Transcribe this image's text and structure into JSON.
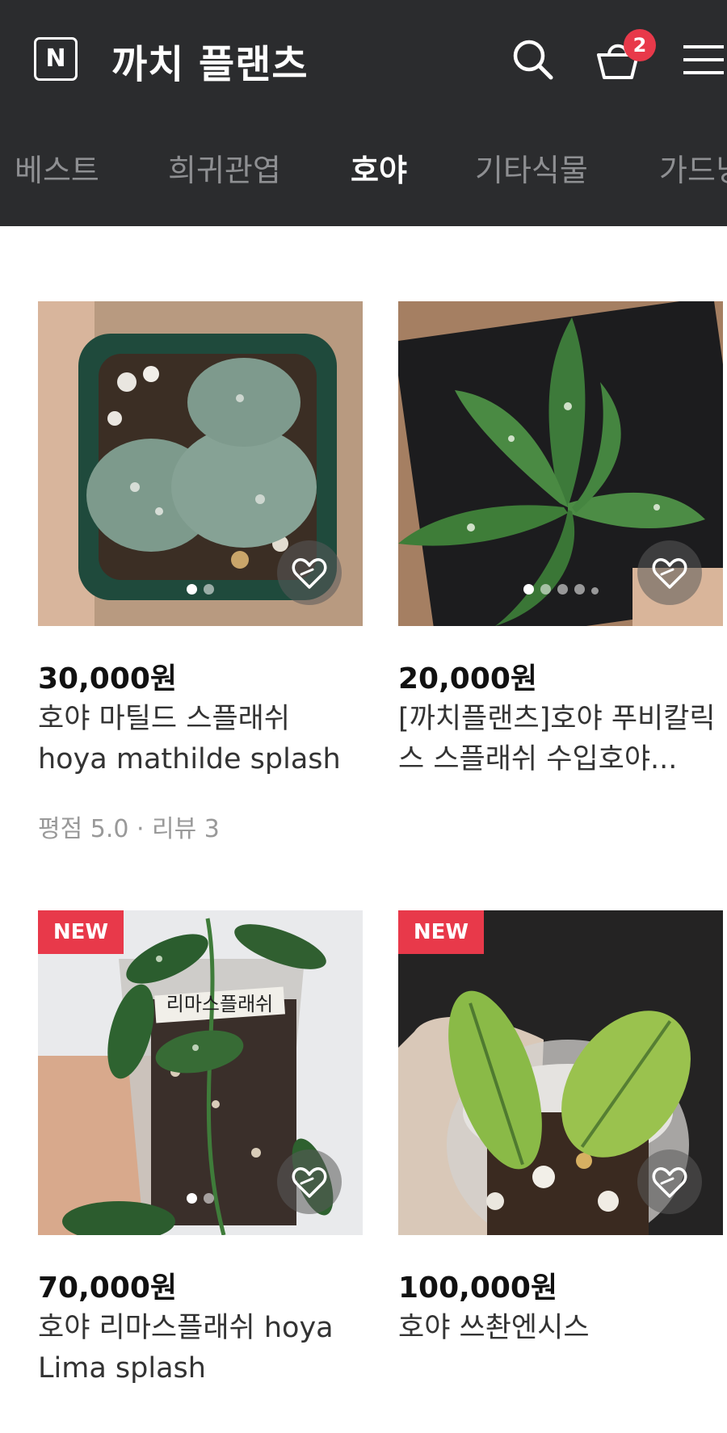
{
  "header": {
    "logo_letter": "N",
    "store_name": "까치 플랜츠",
    "cart_count": "2"
  },
  "tabs": [
    {
      "label": "베스트",
      "active": false
    },
    {
      "label": "희귀관엽",
      "active": false
    },
    {
      "label": "호야",
      "active": true
    },
    {
      "label": "기타식물",
      "active": false
    },
    {
      "label": "가드닝",
      "active": false
    }
  ],
  "products": [
    {
      "price": "30,000원",
      "name": "호야 마틸드 스플래쉬 hoya mathilde splash",
      "rating": "평점 5.0 · 리뷰 3",
      "badge": "",
      "image_dots": 2,
      "image_index": 0
    },
    {
      "price": "20,000원",
      "name": "[까치플랜츠]호야 푸비칼릭스 스플래쉬 수입호야...",
      "rating": "",
      "badge": "",
      "image_dots": 5,
      "image_index": 0
    },
    {
      "price": "70,000원",
      "name": "호야 리마스플래쉬 hoya Lima splash",
      "rating": "",
      "badge": "NEW",
      "image_dots": 2,
      "image_index": 0,
      "pot_label": "리마스플래쉬"
    },
    {
      "price": "100,000원",
      "name": "호야 쓰촨엔시스",
      "rating": "",
      "badge": "NEW",
      "image_dots": 0,
      "image_index": 0
    }
  ],
  "colors": {
    "header_bg": "#2b2c2e",
    "badge_red": "#e8394a",
    "tab_inactive": "#8e8f92"
  }
}
